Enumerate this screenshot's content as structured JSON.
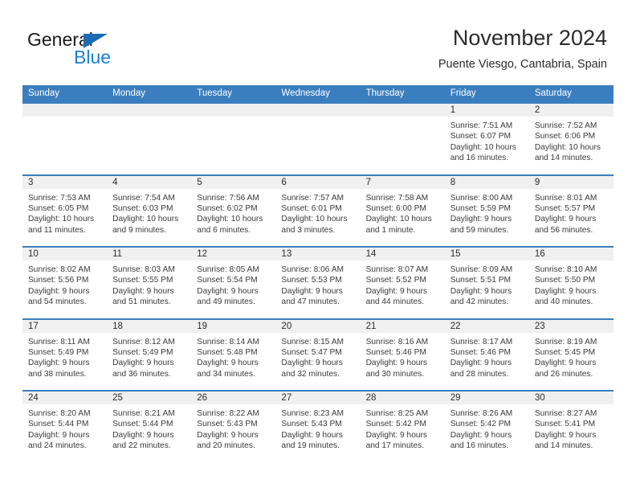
{
  "brand": {
    "name_part1": "General",
    "name_part2": "Blue",
    "triangle_color": "#1c6cb5",
    "blue_color": "#1c7fd6"
  },
  "header": {
    "title": "November 2024",
    "subtitle": "Puente Viesgo, Cantabria, Spain"
  },
  "theme": {
    "header_blue": "#3a7ebf",
    "num_band_gray": "#f0f0f0",
    "text_color": "#3a3a3a"
  },
  "weekdays": [
    "Sunday",
    "Monday",
    "Tuesday",
    "Wednesday",
    "Thursday",
    "Friday",
    "Saturday"
  ],
  "weeks": [
    [
      {
        "day": "",
        "sunrise": "",
        "sunset": "",
        "daylight_line1": "",
        "daylight_line2": ""
      },
      {
        "day": "",
        "sunrise": "",
        "sunset": "",
        "daylight_line1": "",
        "daylight_line2": ""
      },
      {
        "day": "",
        "sunrise": "",
        "sunset": "",
        "daylight_line1": "",
        "daylight_line2": ""
      },
      {
        "day": "",
        "sunrise": "",
        "sunset": "",
        "daylight_line1": "",
        "daylight_line2": ""
      },
      {
        "day": "",
        "sunrise": "",
        "sunset": "",
        "daylight_line1": "",
        "daylight_line2": ""
      },
      {
        "day": "1",
        "sunrise": "Sunrise: 7:51 AM",
        "sunset": "Sunset: 6:07 PM",
        "daylight_line1": "Daylight: 10 hours",
        "daylight_line2": "and 16 minutes."
      },
      {
        "day": "2",
        "sunrise": "Sunrise: 7:52 AM",
        "sunset": "Sunset: 6:06 PM",
        "daylight_line1": "Daylight: 10 hours",
        "daylight_line2": "and 14 minutes."
      }
    ],
    [
      {
        "day": "3",
        "sunrise": "Sunrise: 7:53 AM",
        "sunset": "Sunset: 6:05 PM",
        "daylight_line1": "Daylight: 10 hours",
        "daylight_line2": "and 11 minutes."
      },
      {
        "day": "4",
        "sunrise": "Sunrise: 7:54 AM",
        "sunset": "Sunset: 6:03 PM",
        "daylight_line1": "Daylight: 10 hours",
        "daylight_line2": "and 9 minutes."
      },
      {
        "day": "5",
        "sunrise": "Sunrise: 7:56 AM",
        "sunset": "Sunset: 6:02 PM",
        "daylight_line1": "Daylight: 10 hours",
        "daylight_line2": "and 6 minutes."
      },
      {
        "day": "6",
        "sunrise": "Sunrise: 7:57 AM",
        "sunset": "Sunset: 6:01 PM",
        "daylight_line1": "Daylight: 10 hours",
        "daylight_line2": "and 3 minutes."
      },
      {
        "day": "7",
        "sunrise": "Sunrise: 7:58 AM",
        "sunset": "Sunset: 6:00 PM",
        "daylight_line1": "Daylight: 10 hours",
        "daylight_line2": "and 1 minute."
      },
      {
        "day": "8",
        "sunrise": "Sunrise: 8:00 AM",
        "sunset": "Sunset: 5:59 PM",
        "daylight_line1": "Daylight: 9 hours",
        "daylight_line2": "and 59 minutes."
      },
      {
        "day": "9",
        "sunrise": "Sunrise: 8:01 AM",
        "sunset": "Sunset: 5:57 PM",
        "daylight_line1": "Daylight: 9 hours",
        "daylight_line2": "and 56 minutes."
      }
    ],
    [
      {
        "day": "10",
        "sunrise": "Sunrise: 8:02 AM",
        "sunset": "Sunset: 5:56 PM",
        "daylight_line1": "Daylight: 9 hours",
        "daylight_line2": "and 54 minutes."
      },
      {
        "day": "11",
        "sunrise": "Sunrise: 8:03 AM",
        "sunset": "Sunset: 5:55 PM",
        "daylight_line1": "Daylight: 9 hours",
        "daylight_line2": "and 51 minutes."
      },
      {
        "day": "12",
        "sunrise": "Sunrise: 8:05 AM",
        "sunset": "Sunset: 5:54 PM",
        "daylight_line1": "Daylight: 9 hours",
        "daylight_line2": "and 49 minutes."
      },
      {
        "day": "13",
        "sunrise": "Sunrise: 8:06 AM",
        "sunset": "Sunset: 5:53 PM",
        "daylight_line1": "Daylight: 9 hours",
        "daylight_line2": "and 47 minutes."
      },
      {
        "day": "14",
        "sunrise": "Sunrise: 8:07 AM",
        "sunset": "Sunset: 5:52 PM",
        "daylight_line1": "Daylight: 9 hours",
        "daylight_line2": "and 44 minutes."
      },
      {
        "day": "15",
        "sunrise": "Sunrise: 8:09 AM",
        "sunset": "Sunset: 5:51 PM",
        "daylight_line1": "Daylight: 9 hours",
        "daylight_line2": "and 42 minutes."
      },
      {
        "day": "16",
        "sunrise": "Sunrise: 8:10 AM",
        "sunset": "Sunset: 5:50 PM",
        "daylight_line1": "Daylight: 9 hours",
        "daylight_line2": "and 40 minutes."
      }
    ],
    [
      {
        "day": "17",
        "sunrise": "Sunrise: 8:11 AM",
        "sunset": "Sunset: 5:49 PM",
        "daylight_line1": "Daylight: 9 hours",
        "daylight_line2": "and 38 minutes."
      },
      {
        "day": "18",
        "sunrise": "Sunrise: 8:12 AM",
        "sunset": "Sunset: 5:49 PM",
        "daylight_line1": "Daylight: 9 hours",
        "daylight_line2": "and 36 minutes."
      },
      {
        "day": "19",
        "sunrise": "Sunrise: 8:14 AM",
        "sunset": "Sunset: 5:48 PM",
        "daylight_line1": "Daylight: 9 hours",
        "daylight_line2": "and 34 minutes."
      },
      {
        "day": "20",
        "sunrise": "Sunrise: 8:15 AM",
        "sunset": "Sunset: 5:47 PM",
        "daylight_line1": "Daylight: 9 hours",
        "daylight_line2": "and 32 minutes."
      },
      {
        "day": "21",
        "sunrise": "Sunrise: 8:16 AM",
        "sunset": "Sunset: 5:46 PM",
        "daylight_line1": "Daylight: 9 hours",
        "daylight_line2": "and 30 minutes."
      },
      {
        "day": "22",
        "sunrise": "Sunrise: 8:17 AM",
        "sunset": "Sunset: 5:46 PM",
        "daylight_line1": "Daylight: 9 hours",
        "daylight_line2": "and 28 minutes."
      },
      {
        "day": "23",
        "sunrise": "Sunrise: 8:19 AM",
        "sunset": "Sunset: 5:45 PM",
        "daylight_line1": "Daylight: 9 hours",
        "daylight_line2": "and 26 minutes."
      }
    ],
    [
      {
        "day": "24",
        "sunrise": "Sunrise: 8:20 AM",
        "sunset": "Sunset: 5:44 PM",
        "daylight_line1": "Daylight: 9 hours",
        "daylight_line2": "and 24 minutes."
      },
      {
        "day": "25",
        "sunrise": "Sunrise: 8:21 AM",
        "sunset": "Sunset: 5:44 PM",
        "daylight_line1": "Daylight: 9 hours",
        "daylight_line2": "and 22 minutes."
      },
      {
        "day": "26",
        "sunrise": "Sunrise: 8:22 AM",
        "sunset": "Sunset: 5:43 PM",
        "daylight_line1": "Daylight: 9 hours",
        "daylight_line2": "and 20 minutes."
      },
      {
        "day": "27",
        "sunrise": "Sunrise: 8:23 AM",
        "sunset": "Sunset: 5:43 PM",
        "daylight_line1": "Daylight: 9 hours",
        "daylight_line2": "and 19 minutes."
      },
      {
        "day": "28",
        "sunrise": "Sunrise: 8:25 AM",
        "sunset": "Sunset: 5:42 PM",
        "daylight_line1": "Daylight: 9 hours",
        "daylight_line2": "and 17 minutes."
      },
      {
        "day": "29",
        "sunrise": "Sunrise: 8:26 AM",
        "sunset": "Sunset: 5:42 PM",
        "daylight_line1": "Daylight: 9 hours",
        "daylight_line2": "and 16 minutes."
      },
      {
        "day": "30",
        "sunrise": "Sunrise: 8:27 AM",
        "sunset": "Sunset: 5:41 PM",
        "daylight_line1": "Daylight: 9 hours",
        "daylight_line2": "and 14 minutes."
      }
    ]
  ]
}
